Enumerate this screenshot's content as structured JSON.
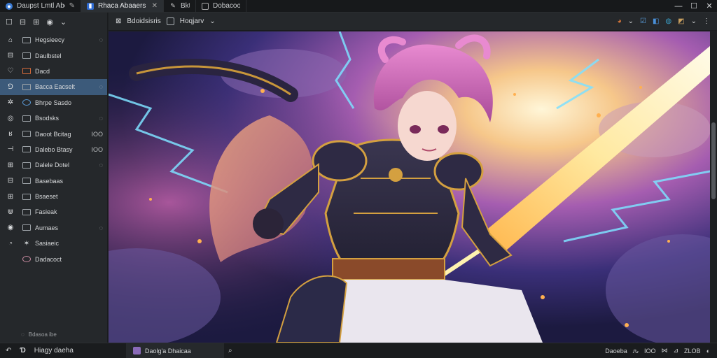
{
  "tabs": [
    {
      "label": "Daupst Lmtl Abcoates",
      "icon": "browser-globe-icon",
      "close": "✎"
    },
    {
      "label": "Rhaca Abaaers",
      "icon": "document-icon",
      "close": "✕"
    },
    {
      "label": "Bkta",
      "icon": "edit-icon",
      "close": ""
    },
    {
      "label": "Dobacoos",
      "icon": "image-icon",
      "close": ""
    }
  ],
  "window_controls": {
    "minimize": "—",
    "maximize": "☐",
    "close": "✕"
  },
  "sidebar": {
    "toolbar": [
      "☐",
      "⊟",
      "⊞",
      "◉",
      "⌄"
    ],
    "items": [
      {
        "lead": "⌂",
        "icon": "folder-icon",
        "name": "Hegsieecy",
        "tail": "◌"
      },
      {
        "lead": "⊟",
        "icon": "folder-icon",
        "name": "Daulbstel",
        "tail": ""
      },
      {
        "lead": "♡",
        "icon": "folder-red-icon",
        "name": "Dacd",
        "tail": ""
      },
      {
        "lead": "⅁",
        "icon": "folder-icon",
        "name": "Bacca Eacselt",
        "tail": "◌"
      },
      {
        "lead": "✲",
        "icon": "globe-icon",
        "name": "Bhrpe Sasdo",
        "tail": ""
      },
      {
        "lead": "◎",
        "icon": "folder-icon",
        "name": "Bsodsks",
        "tail": "◌"
      },
      {
        "lead": "ʁ",
        "icon": "folder-icon",
        "name": "Daoot Bcitag",
        "tail": "IOO"
      },
      {
        "lead": "⊣",
        "icon": "folder-icon",
        "name": "Dalebo Btasy",
        "tail": "IOO"
      },
      {
        "lead": "⊞",
        "icon": "folder-icon",
        "name": "Dalele Dotel",
        "tail": "◌"
      },
      {
        "lead": "⊟",
        "icon": "folder-icon",
        "name": "Basebaas",
        "tail": ""
      },
      {
        "lead": "⊞",
        "icon": "folder-icon",
        "name": "Bsaeset",
        "tail": ""
      },
      {
        "lead": "⋓",
        "icon": "folder-icon",
        "name": "Fasieak",
        "tail": ""
      },
      {
        "lead": "◉",
        "icon": "folder-icon",
        "name": "Aumaes",
        "tail": "◌"
      },
      {
        "lead": "◔",
        "icon": "star-icon",
        "name": "Sasiaeic",
        "tail": ""
      },
      {
        "lead": "",
        "icon": "flower-icon",
        "name": "Dadacoct",
        "tail": ""
      }
    ],
    "footer": "Bdasoa ibe"
  },
  "main_toolbar": {
    "items": [
      "Bdoidsisris",
      "Hoqjarv"
    ],
    "right_icons": [
      "◕",
      "⌄",
      "☑",
      "◧",
      "◍",
      "◩",
      "⌄",
      "⋮"
    ]
  },
  "statusbar": {
    "left_icons": [
      "↶",
      "Ɗ"
    ],
    "left_label": "Hiagy daeha",
    "doc_label": "Daolg'a Dhaicaa",
    "ref_icon": "⌕",
    "right": [
      "Daoeba",
      "ԉ",
      "IOO",
      "⋈",
      "⊿",
      "ZLOB",
      "◐"
    ]
  },
  "colors": {
    "accent": "#3c5a7a",
    "background": "#1e2022"
  }
}
